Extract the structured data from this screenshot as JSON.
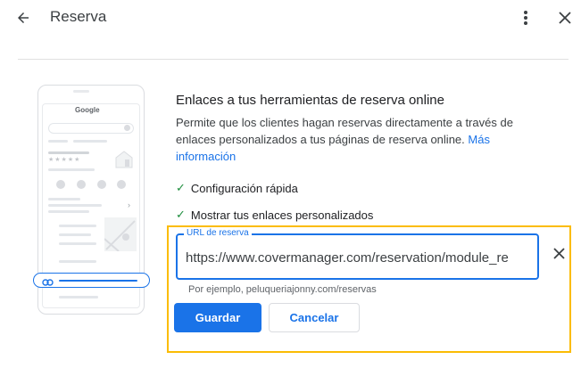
{
  "header": {
    "title": "Reserva"
  },
  "illustration": {
    "brand": "Google"
  },
  "content": {
    "heading": "Enlaces a tus herramientas de reserva online",
    "description": "Permite que los clientes hagan reservas directamente a través de enlaces personalizados a tus páginas de reserva online.",
    "more_info_link": "Más información",
    "features": [
      "Configuración rápida",
      "Mostrar tus enlaces personalizados"
    ]
  },
  "form": {
    "field_label": "URL de reserva",
    "field_value": "https://www.covermanager.com/reservation/module_re",
    "hint": "Por ejemplo, peluqueriajonny.com/reservas",
    "save_label": "Guardar",
    "cancel_label": "Cancelar"
  },
  "colors": {
    "accent": "#1a73e8",
    "highlight": "#fbbc04",
    "check": "#1e8e3e"
  }
}
